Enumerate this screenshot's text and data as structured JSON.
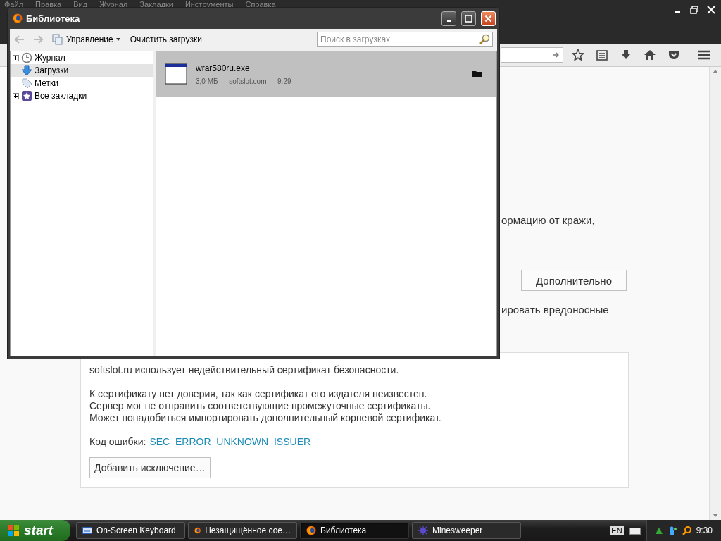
{
  "browser": {
    "menu": [
      "Файл",
      "Правка",
      "Вид",
      "Журнал",
      "Закладки",
      "Инструменты",
      "Справка"
    ]
  },
  "error_page": {
    "fragment_1": "ормацию от кражи,",
    "advanced_button": "Дополнительно",
    "fragment_2": "ировать вредоносные",
    "details": {
      "paragraphs": [
        [
          "softslot.ru использует недействительный сертификат безопасности."
        ],
        [
          "К сертификату нет доверия, так как сертификат его издателя неизвестен.",
          "Сервер мог не отправить соответствующие промежуточные сертификаты.",
          "Может понадобиться импортировать дополнительный корневой сертификат."
        ]
      ],
      "error_code_label": "Код ошибки:",
      "error_code": "SEC_ERROR_UNKNOWN_ISSUER",
      "exception_button": "Добавить исключение…"
    }
  },
  "library": {
    "title": "Библиотека",
    "organize": "Управление",
    "clear": "Очистить загрузки",
    "search": {
      "placeholder": "Поиск в загрузках"
    },
    "sidebar": [
      {
        "label": "Журнал",
        "kind": "history",
        "expandable": true,
        "selected": false
      },
      {
        "label": "Загрузки",
        "kind": "downloads",
        "expandable": false,
        "selected": true
      },
      {
        "label": "Метки",
        "kind": "tags",
        "expandable": false,
        "selected": false
      },
      {
        "label": "Все закладки",
        "kind": "bookmarks",
        "expandable": true,
        "selected": false
      }
    ],
    "downloads": [
      {
        "name": "wrar580ru.exe",
        "info": "3,0 МБ — softslot.com — 9:29",
        "selected": true
      }
    ]
  },
  "taskbar": {
    "start": "start",
    "tasks": [
      {
        "label": "On-Screen Keyboard",
        "kind": "keyboard",
        "selected": false
      },
      {
        "label": "Незащищённое сое…",
        "kind": "firefox",
        "selected": false
      },
      {
        "label": "Библиотека",
        "kind": "firefox",
        "selected": true
      },
      {
        "label": "Minesweeper",
        "kind": "mine",
        "selected": false
      }
    ],
    "language": "EN",
    "clock": "9:30"
  }
}
